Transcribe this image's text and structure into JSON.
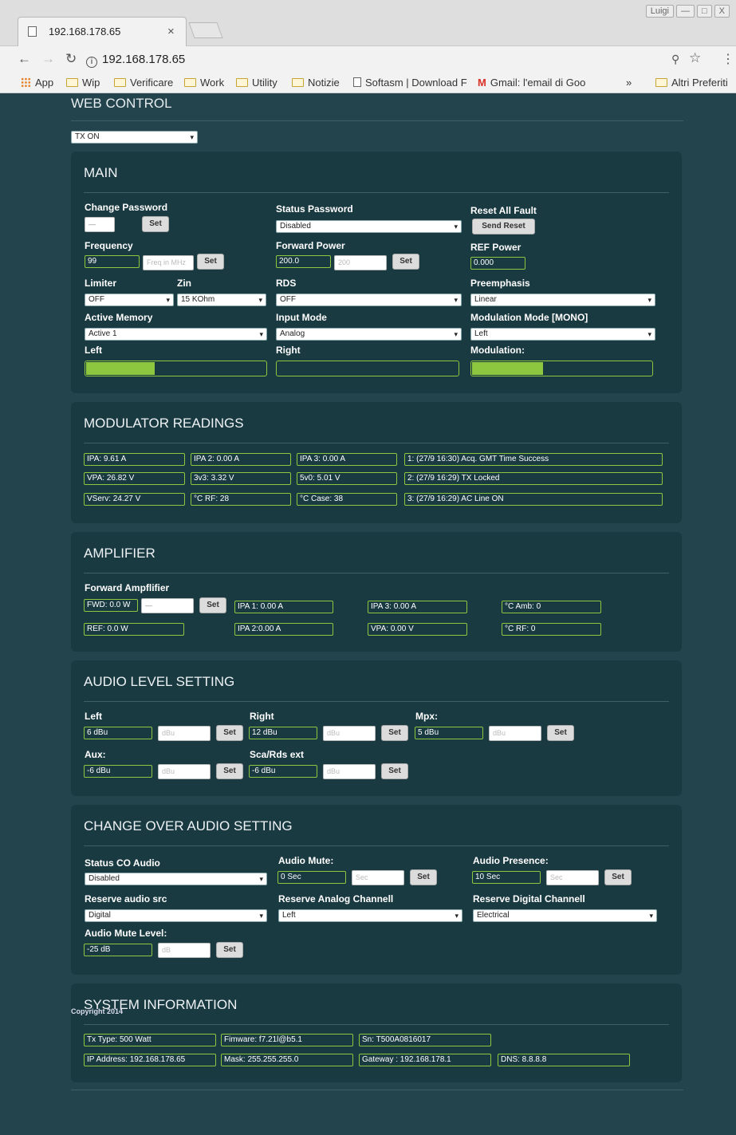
{
  "browser": {
    "tab_title": "192.168.178.65",
    "tab_close": "×",
    "url": "192.168.178.65",
    "user_badge": "Luigi",
    "win_minimize": "—",
    "win_maximize": "□",
    "win_close": "X",
    "bookmarks": {
      "apps": "App",
      "items": [
        "Wip",
        "Verificare",
        "Work",
        "Utility",
        "Notizie",
        "Softasm | Download F",
        "Gmail: l'email di Goo"
      ],
      "more": "»",
      "other": "Altri Preferiti"
    }
  },
  "page": {
    "title": "WEB CONTROL",
    "tx_select": "TX ON",
    "copyright": "Copyright 2014"
  },
  "main": {
    "title": "MAIN",
    "change_password": {
      "label": "Change Password",
      "value": "—",
      "set": "Set"
    },
    "status_password": {
      "label": "Status Password",
      "value": "Disabled"
    },
    "reset_fault": {
      "label": "Reset All Fault",
      "button": "Send Reset"
    },
    "frequency": {
      "label": "Frequency",
      "value": "99",
      "placeholder": "Freq in MHz",
      "set": "Set"
    },
    "forward_power": {
      "label": "Forward Power",
      "value": "200.0",
      "placeholder": "200",
      "set": "Set"
    },
    "ref_power": {
      "label": "REF Power",
      "value": "0.000"
    },
    "limiter": {
      "label": "Limiter",
      "value": "OFF"
    },
    "zin": {
      "label": "Zin",
      "value": "15 KOhm"
    },
    "rds": {
      "label": "RDS",
      "value": "OFF"
    },
    "preemphasis": {
      "label": "Preemphasis",
      "value": "Linear"
    },
    "active_memory": {
      "label": "Active Memory",
      "value": "Active 1"
    },
    "input_mode": {
      "label": "Input Mode",
      "value": "Analog"
    },
    "modulation_mode": {
      "label": "Modulation Mode [MONO]",
      "value": "Left"
    },
    "left_meter": {
      "label": "Left",
      "level": 0.38
    },
    "right_meter": {
      "label": "Right",
      "level": 0
    },
    "modulation_meter": {
      "label": "Modulation:",
      "level": 0.39
    }
  },
  "modulator": {
    "title": "MODULATOR READINGS",
    "col1": [
      "IPA: 9.61 A",
      "VPA: 26.82 V",
      "VServ: 24.27 V"
    ],
    "col2": [
      "IPA 2: 0.00 A",
      "3v3: 3.32 V",
      "°C RF: 28"
    ],
    "col3": [
      "IPA 3: 0.00 A",
      "5v0: 5.01 V",
      "°C Case: 38"
    ],
    "log": [
      "1: (27/9 16:30) Acq. GMT Time Success",
      "2: (27/9 16:29) TX Locked",
      "3: (27/9 16:29) AC Line ON"
    ]
  },
  "amplifier": {
    "title": "AMPLIFIER",
    "forward_label": "Forward Ampflifier",
    "fwd": "FWD: 0.0 W",
    "fwd_input": "—",
    "set": "Set",
    "ref": "REF: 0.0 W",
    "ipa1": "IPA 1: 0.00 A",
    "ipa2": "IPA 2:0.00 A",
    "ipa3": "IPA 3: 0.00 A",
    "vpa": "VPA: 0.00 V",
    "amb": "°C Amb: 0",
    "rf": "°C RF: 0"
  },
  "audio_level": {
    "title": "AUDIO LEVEL SETTING",
    "left": {
      "label": "Left",
      "value": "6 dBu",
      "placeholder": "dBu",
      "set": "Set"
    },
    "right": {
      "label": "Right",
      "value": "12 dBu",
      "placeholder": "dBu",
      "set": "Set"
    },
    "mpx": {
      "label": "Mpx:",
      "value": "5 dBu",
      "placeholder": "dBu",
      "set": "Set"
    },
    "aux": {
      "label": "Aux:",
      "value": "-6 dBu",
      "placeholder": "dBu",
      "set": "Set"
    },
    "sca": {
      "label": "Sca/Rds ext",
      "value": "-6 dBu",
      "placeholder": "dBu",
      "set": "Set"
    }
  },
  "changeover": {
    "title": "CHANGE OVER AUDIO SETTING",
    "status": {
      "label": "Status CO Audio",
      "value": "Disabled"
    },
    "mute": {
      "label": "Audio Mute:",
      "value": "0 Sec",
      "placeholder": "Sec",
      "set": "Set"
    },
    "presence": {
      "label": "Audio Presence:",
      "value": "10 Sec",
      "placeholder": "Sec",
      "set": "Set"
    },
    "reserve_src": {
      "label": "Reserve audio src",
      "value": "Digital"
    },
    "reserve_analog": {
      "label": "Reserve Analog Channell",
      "value": "Left"
    },
    "reserve_digital": {
      "label": "Reserve Digital Channell",
      "value": "Electrical"
    },
    "mute_level": {
      "label": "Audio Mute Level:",
      "value": "-25 dB",
      "placeholder": "dB",
      "set": "Set"
    }
  },
  "system": {
    "title": "SYSTEM INFORMATION",
    "tx_type": "Tx Type: 500 Watt",
    "firmware": "Fimware: f7.21l@b5.1",
    "sn": "Sn: T500A0816017",
    "ip": "IP Address: 192.168.178.65",
    "mask": "Mask: 255.255.255.0",
    "gateway": "Gateway : 192.168.178.1",
    "dns": "DNS: 8.8.8.8"
  },
  "colors": {
    "page_bg": "#23444d",
    "panel_bg": "#1a3a42",
    "accent_green": "#8dc63f"
  }
}
